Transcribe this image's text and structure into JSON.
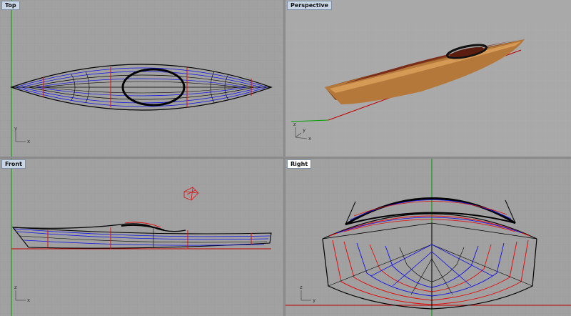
{
  "viewports": {
    "top": {
      "label": "Top",
      "axis_x": "x",
      "axis_y": "y"
    },
    "perspective": {
      "label": "Perspective",
      "axis_x": "x",
      "axis_y": "y",
      "axis_z": "z"
    },
    "front": {
      "label": "Front",
      "axis_x": "x",
      "axis_y": "z"
    },
    "right": {
      "label": "Right",
      "axis_x": "y",
      "axis_y": "z"
    }
  },
  "colors": {
    "background": "#a1a1a1",
    "grid": "#969696",
    "grid_major": "#8c8c8c",
    "curve_black": "#000000",
    "curve_blue": "#1010e8",
    "curve_red": "#e01010",
    "axis_green": "#00a000",
    "axis_red": "#c00000",
    "hull_wood": "#b5783b",
    "deck_wood": "#7a2c1a"
  },
  "active_viewport": "right"
}
